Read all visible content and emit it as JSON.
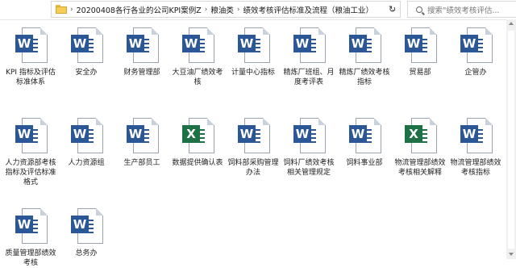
{
  "address": {
    "crumbs": [
      "20200408各行各业的公司KPI案例Z",
      "粮油类",
      "绩效考核评估标准及流程（粮油工业）"
    ],
    "separator": "›",
    "dropdown": "⌄",
    "refresh": "↻"
  },
  "search": {
    "placeholder": "搜索\"绩效考核评估..."
  },
  "files": [
    {
      "name": "KPI 指标及评估标准体系",
      "type": "word"
    },
    {
      "name": "安全办",
      "type": "word"
    },
    {
      "name": "财务管理部",
      "type": "word"
    },
    {
      "name": "大豆油厂绩效考核",
      "type": "word"
    },
    {
      "name": "计量中心指标",
      "type": "word"
    },
    {
      "name": "精炼厂班组、月度考评表",
      "type": "word"
    },
    {
      "name": "精炼厂绩效考核指标",
      "type": "word"
    },
    {
      "name": "贸易部",
      "type": "word"
    },
    {
      "name": "企管办",
      "type": "word"
    },
    {
      "name": "人力资源部考核指标及评估标准格式",
      "type": "word"
    },
    {
      "name": "人力资源组",
      "type": "word"
    },
    {
      "name": "生产部员工",
      "type": "word"
    },
    {
      "name": "数据提供确认表",
      "type": "excel"
    },
    {
      "name": "饲料部采购管理办法",
      "type": "word"
    },
    {
      "name": "饲料厂绩效考核相关管理规定",
      "type": "word"
    },
    {
      "name": "饲料事业部",
      "type": "word"
    },
    {
      "name": "物流管理部绩效考核相关解释",
      "type": "excel"
    },
    {
      "name": "物流管理部绩效考核指标",
      "type": "word"
    },
    {
      "name": "质量管理部绩效考核",
      "type": "word"
    },
    {
      "name": "总务办",
      "type": "word"
    }
  ],
  "icons": {
    "word": "W",
    "excel": "X"
  },
  "colors": {
    "word": "#2b5797",
    "excel": "#1e7145",
    "folder": "#f5cc54"
  }
}
